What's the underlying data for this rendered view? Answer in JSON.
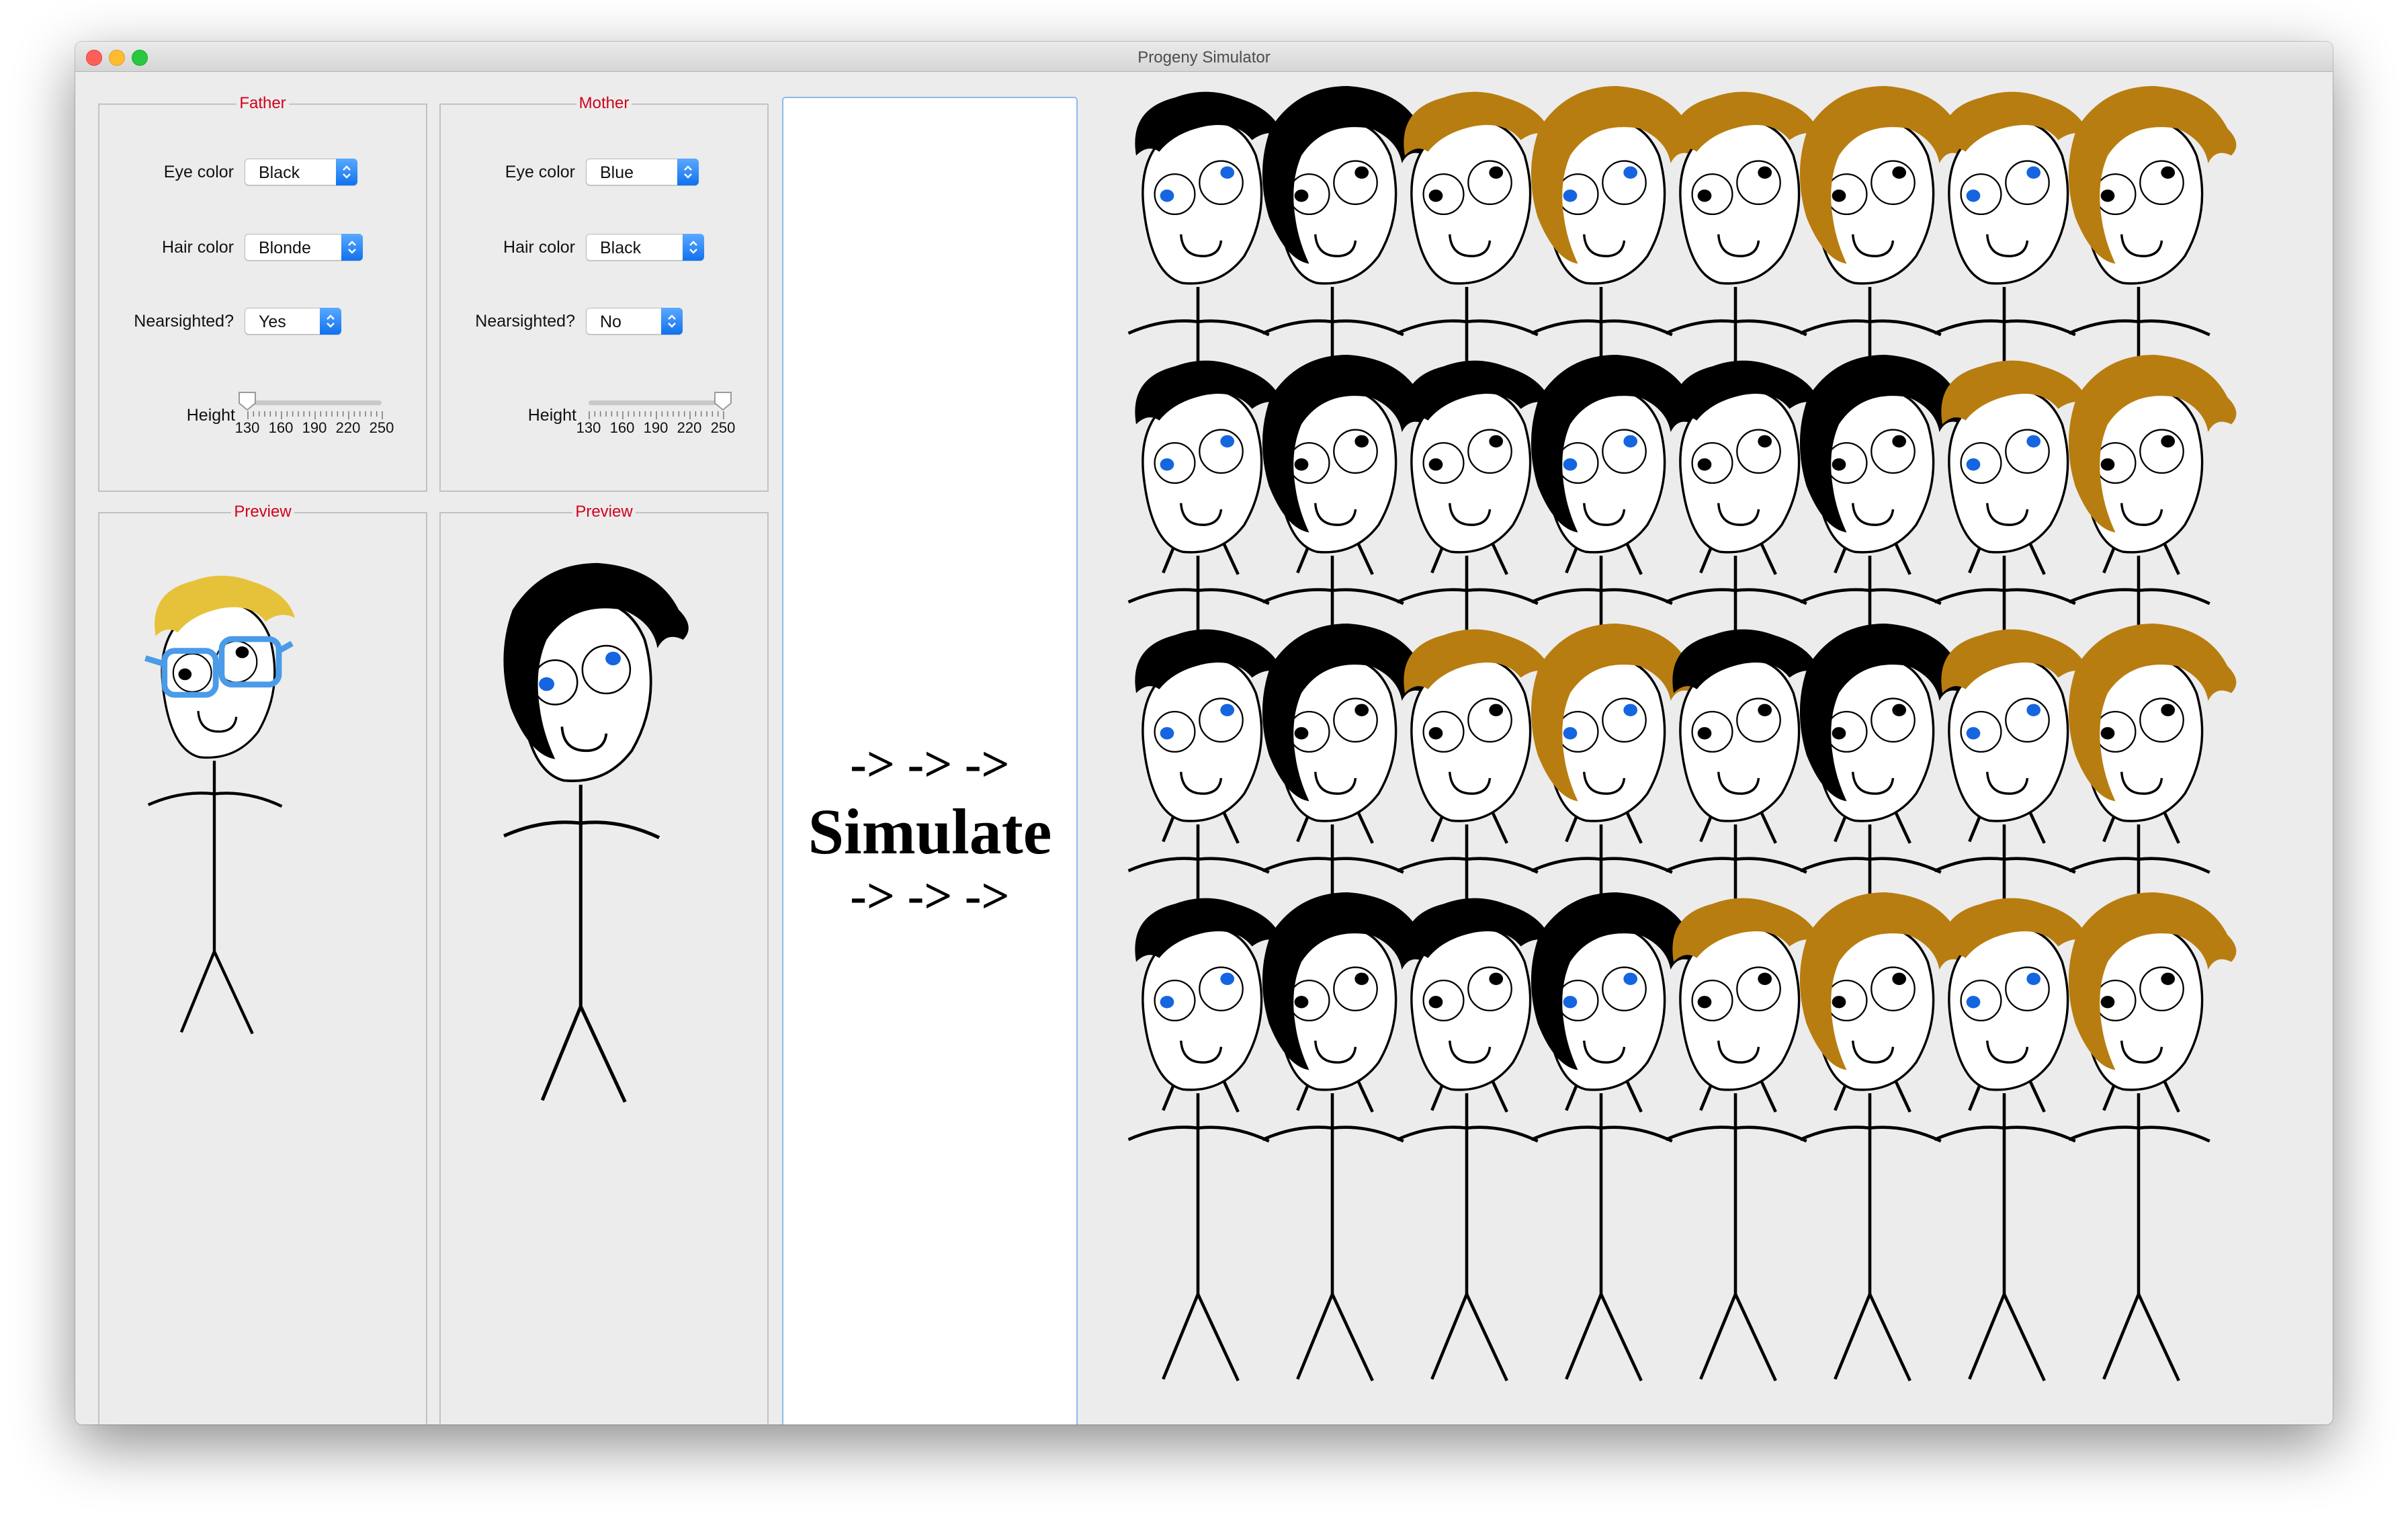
{
  "window": {
    "title": "Progeny Simulator"
  },
  "father": {
    "group_title": "Father",
    "eye_color_label": "Eye color",
    "eye_color_value": "Black",
    "hair_color_label": "Hair color",
    "hair_color_value": "Blonde",
    "nearsighted_label": "Nearsighted?",
    "nearsighted_value": "Yes",
    "height_label": "Height",
    "height_fraction": 0.0,
    "preview_title": "Preview",
    "preview_hair": "blonde",
    "preview_eyes": "black",
    "preview_glasses": true
  },
  "mother": {
    "group_title": "Mother",
    "eye_color_label": "Eye color",
    "eye_color_value": "Blue",
    "hair_color_label": "Hair color",
    "hair_color_value": "Black",
    "nearsighted_label": "Nearsighted?",
    "nearsighted_value": "No",
    "height_label": "Height",
    "height_fraction": 1.0,
    "preview_title": "Preview",
    "preview_hair": "black",
    "preview_eyes": "blue",
    "preview_glasses": false
  },
  "slider_ticks": [
    "130",
    "160",
    "190",
    "220",
    "250"
  ],
  "simulate": {
    "line1": "-> -> ->",
    "line2": "Simulate",
    "line3": "-> -> ->"
  },
  "colors": {
    "title_red": "#d0021b",
    "blonde": "#e6c23a",
    "brown": "#b87d10",
    "black": "#000000",
    "blue": "#1565e0",
    "glasses": "#4a9be8",
    "focus": "#8db8ef"
  },
  "offspring": {
    "rows": [
      [
        "black-m",
        "black-f",
        "brown-m",
        "brown-f",
        "brown-m",
        "brown-f",
        "brown-m",
        "brown-f"
      ],
      [
        "black-m",
        "black-f",
        "black-m",
        "black-f",
        "black-m",
        "black-f",
        "brown-m",
        "brown-f"
      ],
      [
        "black-m",
        "black-f",
        "brown-m",
        "brown-f",
        "black-m",
        "black-f",
        "brown-m",
        "brown-f"
      ],
      [
        "black-m",
        "black-f",
        "black-m",
        "black-f",
        "brown-m",
        "brown-f",
        "brown-m",
        "brown-f"
      ]
    ]
  }
}
